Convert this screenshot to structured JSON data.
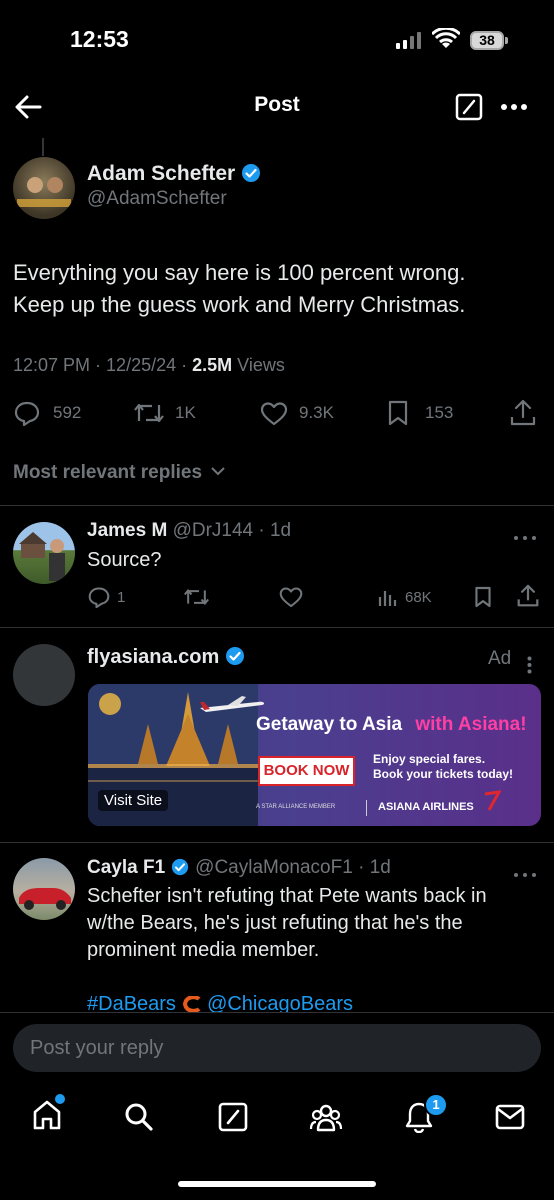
{
  "status_bar": {
    "time": "12:53",
    "battery": "38"
  },
  "header": {
    "title": "Post"
  },
  "tweet": {
    "author_name": "Adam Schefter",
    "author_handle": "@AdamSchefter",
    "text_line1": "Everything you say here is 100 percent wrong.",
    "text_line2": "Keep up the guess work and Merry Christmas.",
    "time": "12:07 PM · 12/25/24 · ",
    "views_count": "2.5M",
    "views_label": " Views",
    "replies": "592",
    "reposts": "1K",
    "likes": "9.3K",
    "bookmarks": "153"
  },
  "sort": {
    "label": "Most relevant replies"
  },
  "reply1": {
    "name": "James M",
    "meta": "@DrJ144 · 1d",
    "text": "Source?",
    "replies": "1",
    "views": "68K"
  },
  "ad": {
    "name": "flyasiana.com",
    "ad_label": "Ad",
    "headline": "Getaway to Asia",
    "headline_accent": "with Asiana!",
    "cta": "BOOK NOW",
    "offer_line1": "Enjoy special fares.",
    "offer_line2": "Book your tickets today!",
    "visit_site": "Visit Site",
    "alliance": "A STAR ALLIANCE MEMBER",
    "airline": "ASIANA AIRLINES"
  },
  "reply2": {
    "name": "Cayla F1",
    "meta": "@CaylaMonacoF1 · 1d",
    "text_line1": "Schefter isn't refuting that Pete wants back in",
    "text_line2": "w/the Bears, he's just refuting that he's the",
    "text_line3": "prominent media member.",
    "hashtag": "#DaBears",
    "mention": "@ChicagoBears"
  },
  "composer": {
    "placeholder": "Post your reply"
  },
  "nav": {
    "notifications_badge": "1"
  },
  "colors": {
    "accent": "#1d9bf0",
    "background": "#000000",
    "muted": "#71767b",
    "ad_accent": "#e0218a"
  }
}
